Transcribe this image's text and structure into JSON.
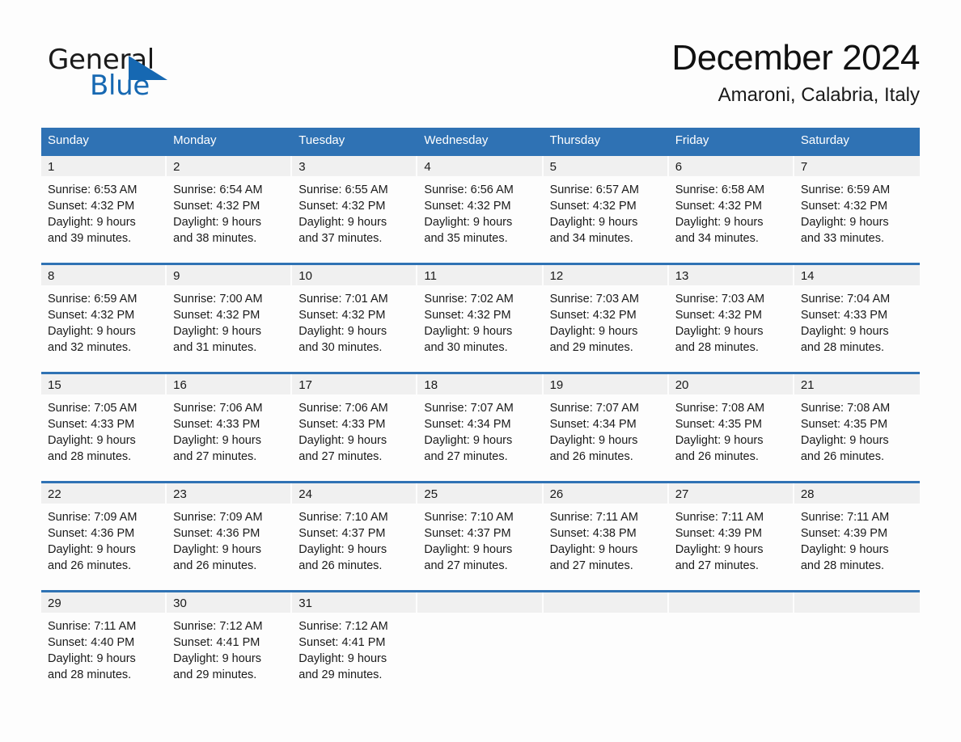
{
  "brand": {
    "name_part1": "General",
    "name_part2": "Blue",
    "logo_icon": "triangle-logo-icon",
    "accent_color": "#1668b2"
  },
  "header": {
    "month_title": "December 2024",
    "location": "Amaroni, Calabria, Italy"
  },
  "theme": {
    "header_blue": "#2f72b4",
    "daynum_strip": "#f0f0f0",
    "page_background": "#fdfdfd"
  },
  "calendar": {
    "weekday_headers": [
      "Sunday",
      "Monday",
      "Tuesday",
      "Wednesday",
      "Thursday",
      "Friday",
      "Saturday"
    ],
    "weeks": [
      [
        {
          "day": "1",
          "sunrise": "Sunrise: 6:53 AM",
          "sunset": "Sunset: 4:32 PM",
          "daylight_1": "Daylight: 9 hours",
          "daylight_2": "and 39 minutes."
        },
        {
          "day": "2",
          "sunrise": "Sunrise: 6:54 AM",
          "sunset": "Sunset: 4:32 PM",
          "daylight_1": "Daylight: 9 hours",
          "daylight_2": "and 38 minutes."
        },
        {
          "day": "3",
          "sunrise": "Sunrise: 6:55 AM",
          "sunset": "Sunset: 4:32 PM",
          "daylight_1": "Daylight: 9 hours",
          "daylight_2": "and 37 minutes."
        },
        {
          "day": "4",
          "sunrise": "Sunrise: 6:56 AM",
          "sunset": "Sunset: 4:32 PM",
          "daylight_1": "Daylight: 9 hours",
          "daylight_2": "and 35 minutes."
        },
        {
          "day": "5",
          "sunrise": "Sunrise: 6:57 AM",
          "sunset": "Sunset: 4:32 PM",
          "daylight_1": "Daylight: 9 hours",
          "daylight_2": "and 34 minutes."
        },
        {
          "day": "6",
          "sunrise": "Sunrise: 6:58 AM",
          "sunset": "Sunset: 4:32 PM",
          "daylight_1": "Daylight: 9 hours",
          "daylight_2": "and 34 minutes."
        },
        {
          "day": "7",
          "sunrise": "Sunrise: 6:59 AM",
          "sunset": "Sunset: 4:32 PM",
          "daylight_1": "Daylight: 9 hours",
          "daylight_2": "and 33 minutes."
        }
      ],
      [
        {
          "day": "8",
          "sunrise": "Sunrise: 6:59 AM",
          "sunset": "Sunset: 4:32 PM",
          "daylight_1": "Daylight: 9 hours",
          "daylight_2": "and 32 minutes."
        },
        {
          "day": "9",
          "sunrise": "Sunrise: 7:00 AM",
          "sunset": "Sunset: 4:32 PM",
          "daylight_1": "Daylight: 9 hours",
          "daylight_2": "and 31 minutes."
        },
        {
          "day": "10",
          "sunrise": "Sunrise: 7:01 AM",
          "sunset": "Sunset: 4:32 PM",
          "daylight_1": "Daylight: 9 hours",
          "daylight_2": "and 30 minutes."
        },
        {
          "day": "11",
          "sunrise": "Sunrise: 7:02 AM",
          "sunset": "Sunset: 4:32 PM",
          "daylight_1": "Daylight: 9 hours",
          "daylight_2": "and 30 minutes."
        },
        {
          "day": "12",
          "sunrise": "Sunrise: 7:03 AM",
          "sunset": "Sunset: 4:32 PM",
          "daylight_1": "Daylight: 9 hours",
          "daylight_2": "and 29 minutes."
        },
        {
          "day": "13",
          "sunrise": "Sunrise: 7:03 AM",
          "sunset": "Sunset: 4:32 PM",
          "daylight_1": "Daylight: 9 hours",
          "daylight_2": "and 28 minutes."
        },
        {
          "day": "14",
          "sunrise": "Sunrise: 7:04 AM",
          "sunset": "Sunset: 4:33 PM",
          "daylight_1": "Daylight: 9 hours",
          "daylight_2": "and 28 minutes."
        }
      ],
      [
        {
          "day": "15",
          "sunrise": "Sunrise: 7:05 AM",
          "sunset": "Sunset: 4:33 PM",
          "daylight_1": "Daylight: 9 hours",
          "daylight_2": "and 28 minutes."
        },
        {
          "day": "16",
          "sunrise": "Sunrise: 7:06 AM",
          "sunset": "Sunset: 4:33 PM",
          "daylight_1": "Daylight: 9 hours",
          "daylight_2": "and 27 minutes."
        },
        {
          "day": "17",
          "sunrise": "Sunrise: 7:06 AM",
          "sunset": "Sunset: 4:33 PM",
          "daylight_1": "Daylight: 9 hours",
          "daylight_2": "and 27 minutes."
        },
        {
          "day": "18",
          "sunrise": "Sunrise: 7:07 AM",
          "sunset": "Sunset: 4:34 PM",
          "daylight_1": "Daylight: 9 hours",
          "daylight_2": "and 27 minutes."
        },
        {
          "day": "19",
          "sunrise": "Sunrise: 7:07 AM",
          "sunset": "Sunset: 4:34 PM",
          "daylight_1": "Daylight: 9 hours",
          "daylight_2": "and 26 minutes."
        },
        {
          "day": "20",
          "sunrise": "Sunrise: 7:08 AM",
          "sunset": "Sunset: 4:35 PM",
          "daylight_1": "Daylight: 9 hours",
          "daylight_2": "and 26 minutes."
        },
        {
          "day": "21",
          "sunrise": "Sunrise: 7:08 AM",
          "sunset": "Sunset: 4:35 PM",
          "daylight_1": "Daylight: 9 hours",
          "daylight_2": "and 26 minutes."
        }
      ],
      [
        {
          "day": "22",
          "sunrise": "Sunrise: 7:09 AM",
          "sunset": "Sunset: 4:36 PM",
          "daylight_1": "Daylight: 9 hours",
          "daylight_2": "and 26 minutes."
        },
        {
          "day": "23",
          "sunrise": "Sunrise: 7:09 AM",
          "sunset": "Sunset: 4:36 PM",
          "daylight_1": "Daylight: 9 hours",
          "daylight_2": "and 26 minutes."
        },
        {
          "day": "24",
          "sunrise": "Sunrise: 7:10 AM",
          "sunset": "Sunset: 4:37 PM",
          "daylight_1": "Daylight: 9 hours",
          "daylight_2": "and 26 minutes."
        },
        {
          "day": "25",
          "sunrise": "Sunrise: 7:10 AM",
          "sunset": "Sunset: 4:37 PM",
          "daylight_1": "Daylight: 9 hours",
          "daylight_2": "and 27 minutes."
        },
        {
          "day": "26",
          "sunrise": "Sunrise: 7:11 AM",
          "sunset": "Sunset: 4:38 PM",
          "daylight_1": "Daylight: 9 hours",
          "daylight_2": "and 27 minutes."
        },
        {
          "day": "27",
          "sunrise": "Sunrise: 7:11 AM",
          "sunset": "Sunset: 4:39 PM",
          "daylight_1": "Daylight: 9 hours",
          "daylight_2": "and 27 minutes."
        },
        {
          "day": "28",
          "sunrise": "Sunrise: 7:11 AM",
          "sunset": "Sunset: 4:39 PM",
          "daylight_1": "Daylight: 9 hours",
          "daylight_2": "and 28 minutes."
        }
      ],
      [
        {
          "day": "29",
          "sunrise": "Sunrise: 7:11 AM",
          "sunset": "Sunset: 4:40 PM",
          "daylight_1": "Daylight: 9 hours",
          "daylight_2": "and 28 minutes."
        },
        {
          "day": "30",
          "sunrise": "Sunrise: 7:12 AM",
          "sunset": "Sunset: 4:41 PM",
          "daylight_1": "Daylight: 9 hours",
          "daylight_2": "and 29 minutes."
        },
        {
          "day": "31",
          "sunrise": "Sunrise: 7:12 AM",
          "sunset": "Sunset: 4:41 PM",
          "daylight_1": "Daylight: 9 hours",
          "daylight_2": "and 29 minutes."
        },
        {
          "day": "",
          "sunrise": "",
          "sunset": "",
          "daylight_1": "",
          "daylight_2": ""
        },
        {
          "day": "",
          "sunrise": "",
          "sunset": "",
          "daylight_1": "",
          "daylight_2": ""
        },
        {
          "day": "",
          "sunrise": "",
          "sunset": "",
          "daylight_1": "",
          "daylight_2": ""
        },
        {
          "day": "",
          "sunrise": "",
          "sunset": "",
          "daylight_1": "",
          "daylight_2": ""
        }
      ]
    ]
  }
}
